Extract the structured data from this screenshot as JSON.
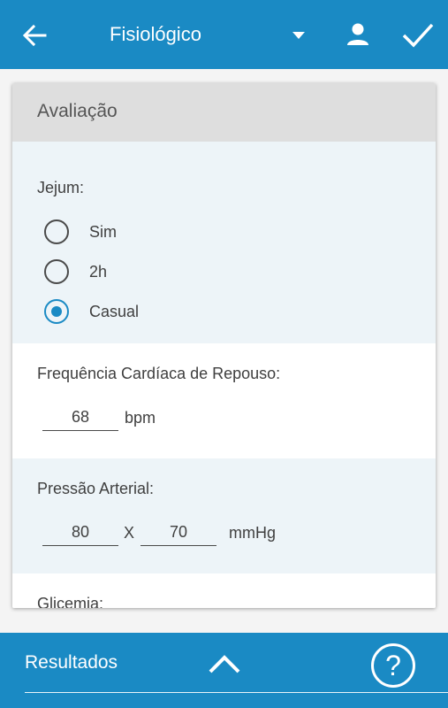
{
  "appbar": {
    "title": "Fisiológico",
    "back_icon": "arrow-left-icon",
    "dropdown_icon": "caret-down-icon",
    "user_icon": "person-icon",
    "confirm_icon": "check-icon"
  },
  "card": {
    "header": "Avaliação",
    "jejum": {
      "label": "Jejum:",
      "options": [
        "Sim",
        "2h",
        "Casual"
      ],
      "selected": "Casual"
    },
    "frequencia": {
      "label": "Frequência Cardíaca de Repouso:",
      "value": "68",
      "unit": "bpm"
    },
    "pressao": {
      "label": "Pressão Arterial:",
      "systolic": "80",
      "separator": "X",
      "diastolic": "70",
      "unit": "mmHg"
    },
    "glicemia": {
      "label": "Glicemia:"
    }
  },
  "bottombar": {
    "label": "Resultados",
    "expand_icon": "chevron-up-icon",
    "help_icon": "help-icon",
    "help_glyph": "?"
  },
  "colors": {
    "primary": "#1a8ac4",
    "section_tint": "#edf4f8",
    "header_gray": "#dedede"
  }
}
